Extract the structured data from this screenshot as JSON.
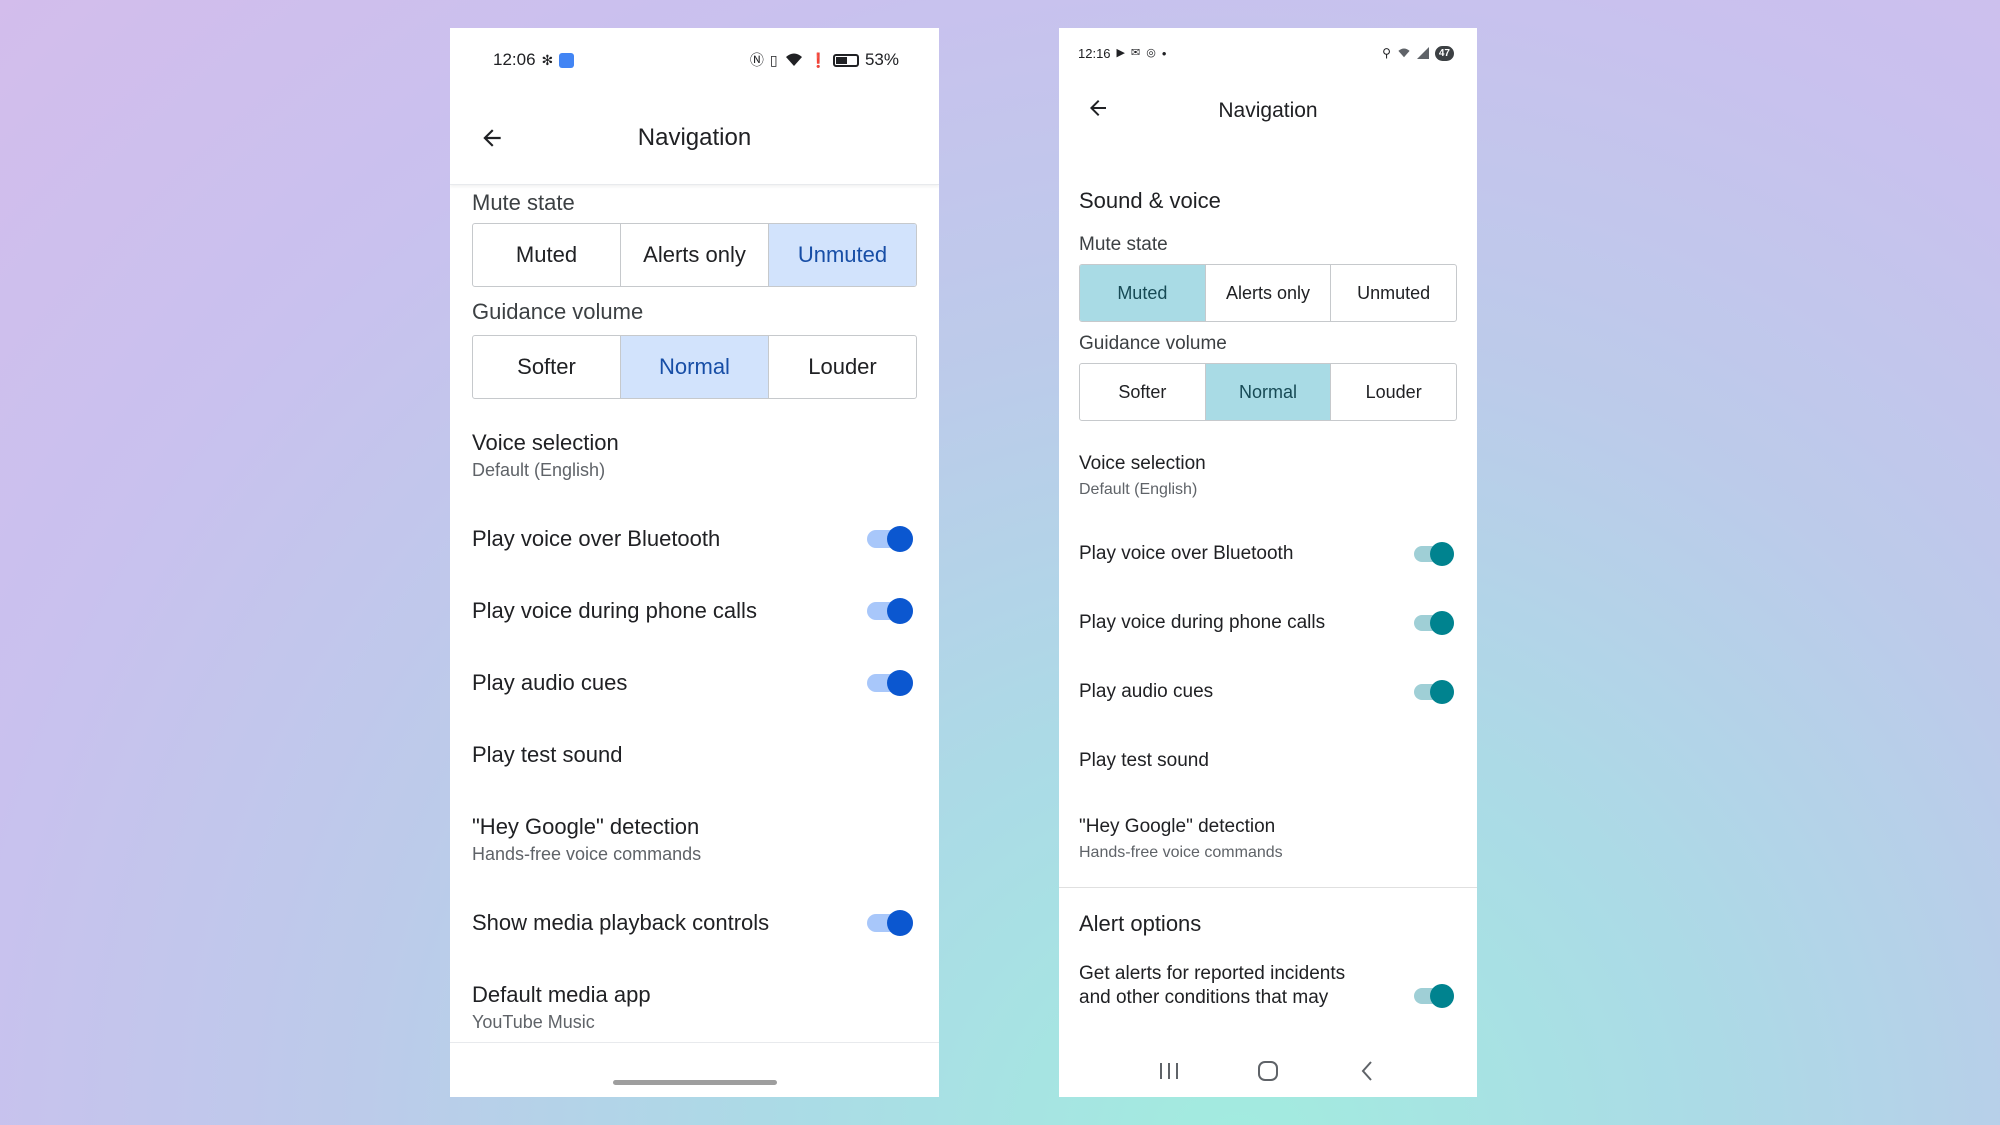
{
  "left_phone": {
    "status": {
      "time": "12:06",
      "battery": "53%"
    },
    "title": "Navigation",
    "mute_state": {
      "label": "Mute state",
      "options": [
        "Muted",
        "Alerts only",
        "Unmuted"
      ],
      "selected": "Unmuted"
    },
    "guidance_volume": {
      "label": "Guidance volume",
      "options": [
        "Softer",
        "Normal",
        "Louder"
      ],
      "selected": "Normal"
    },
    "voice_selection": {
      "title": "Voice selection",
      "subtitle": "Default (English)"
    },
    "bluetooth": {
      "title": "Play voice over Bluetooth",
      "on": true
    },
    "phone_calls": {
      "title": "Play voice during phone calls",
      "on": true
    },
    "audio_cues": {
      "title": "Play audio cues",
      "on": true
    },
    "test_sound": {
      "title": "Play test sound"
    },
    "hey_google": {
      "title": "\"Hey Google\" detection",
      "subtitle": "Hands-free voice commands"
    },
    "media_controls": {
      "title": "Show media playback controls",
      "on": true
    },
    "media_app": {
      "title": "Default media app",
      "subtitle": "YouTube Music"
    }
  },
  "right_phone": {
    "status": {
      "time": "12:16",
      "dot": "•",
      "badge": "47"
    },
    "title": "Navigation",
    "section_sound": "Sound & voice",
    "mute_state": {
      "label": "Mute state",
      "options": [
        "Muted",
        "Alerts only",
        "Unmuted"
      ],
      "selected": "Muted"
    },
    "guidance_volume": {
      "label": "Guidance volume",
      "options": [
        "Softer",
        "Normal",
        "Louder"
      ],
      "selected": "Normal"
    },
    "voice_selection": {
      "title": "Voice selection",
      "subtitle": "Default (English)"
    },
    "bluetooth": {
      "title": "Play voice over Bluetooth",
      "on": true
    },
    "phone_calls": {
      "title": "Play voice during phone calls",
      "on": true
    },
    "audio_cues": {
      "title": "Play audio cues",
      "on": true
    },
    "test_sound": {
      "title": "Play test sound"
    },
    "hey_google": {
      "title": "\"Hey Google\" detection",
      "subtitle": "Hands-free voice commands"
    },
    "section_alerts": "Alert options",
    "alerts": {
      "title_line1": "Get alerts for reported incidents",
      "title_line2": "and other conditions that may",
      "on": true
    }
  },
  "colors": {
    "left_accent": "#0b57d0",
    "left_selected_bg": "#d2e3fc",
    "right_accent": "#00838f",
    "right_selected_bg": "#a9dbe5"
  }
}
